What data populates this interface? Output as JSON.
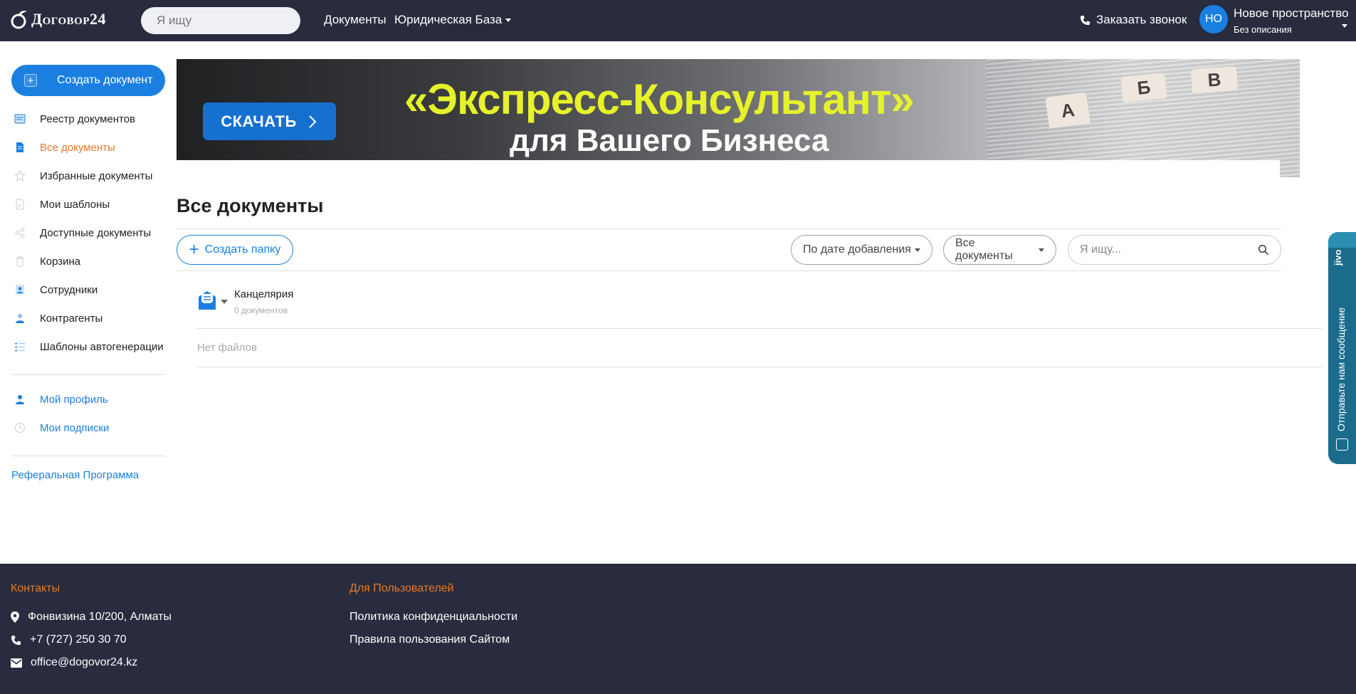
{
  "header": {
    "logo_text": "Договор24",
    "search_placeholder": "Я ищу",
    "nav": [
      {
        "label": "Документы"
      },
      {
        "label": "Юридическая База"
      }
    ],
    "callback_label": "Заказать звонок",
    "avatar_initials": "НО",
    "workspace_name": "Новое пространство",
    "workspace_desc": "Без описания"
  },
  "sidebar": {
    "create_button": "Создать документ",
    "items": [
      {
        "label": "Реестр документов",
        "icon": "registry-icon"
      },
      {
        "label": "Все документы",
        "icon": "document-icon",
        "active": true
      },
      {
        "label": "Избранные документы",
        "icon": "star-icon"
      },
      {
        "label": "Мои шаблоны",
        "icon": "template-icon"
      },
      {
        "label": "Доступные документы",
        "icon": "share-icon"
      },
      {
        "label": "Корзина",
        "icon": "trash-icon"
      },
      {
        "label": "Сотрудники",
        "icon": "employees-icon"
      },
      {
        "label": "Контрагенты",
        "icon": "contractors-icon"
      },
      {
        "label": "Шаблоны автогенерации",
        "icon": "list-check-icon"
      }
    ],
    "profile_items": [
      {
        "label": "Мой профиль",
        "icon": "user-icon"
      },
      {
        "label": "Мои подписки",
        "icon": "clock-icon"
      }
    ],
    "referral": "Реферальная Программа"
  },
  "banner": {
    "download_label": "СКАЧАТЬ",
    "title": "«Экспресс-Консультант»",
    "subtitle": "для Вашего Бизнеса",
    "tabs": [
      "А",
      "Б",
      "В"
    ]
  },
  "main": {
    "title": "Все документы",
    "create_folder": "Создать папку",
    "sort_select": "По дате добавления",
    "filter_select": "Все документы",
    "search_placeholder": "Я ищу...",
    "folder": {
      "name": "Канцелярия",
      "count": "0 документов"
    },
    "no_files": "Нет файлов"
  },
  "jivo": {
    "logo": "jivo",
    "text": "Отправьте нам сообщение"
  },
  "footer": {
    "contacts_title": "Контакты",
    "address": "Фонвизина 10/200, Алматы",
    "phone": "+7 (727) 250 30 70",
    "email": "office@dogovor24.kz",
    "users_title": "Для Пользователей",
    "links": [
      "Политика конфиденциальности",
      "Правила пользования Сайтом"
    ]
  },
  "colors": {
    "header_bg": "#282c3e",
    "accent_blue": "#1a7fe0",
    "accent_orange": "#e8792b",
    "banner_yellow": "#e6f22a"
  }
}
